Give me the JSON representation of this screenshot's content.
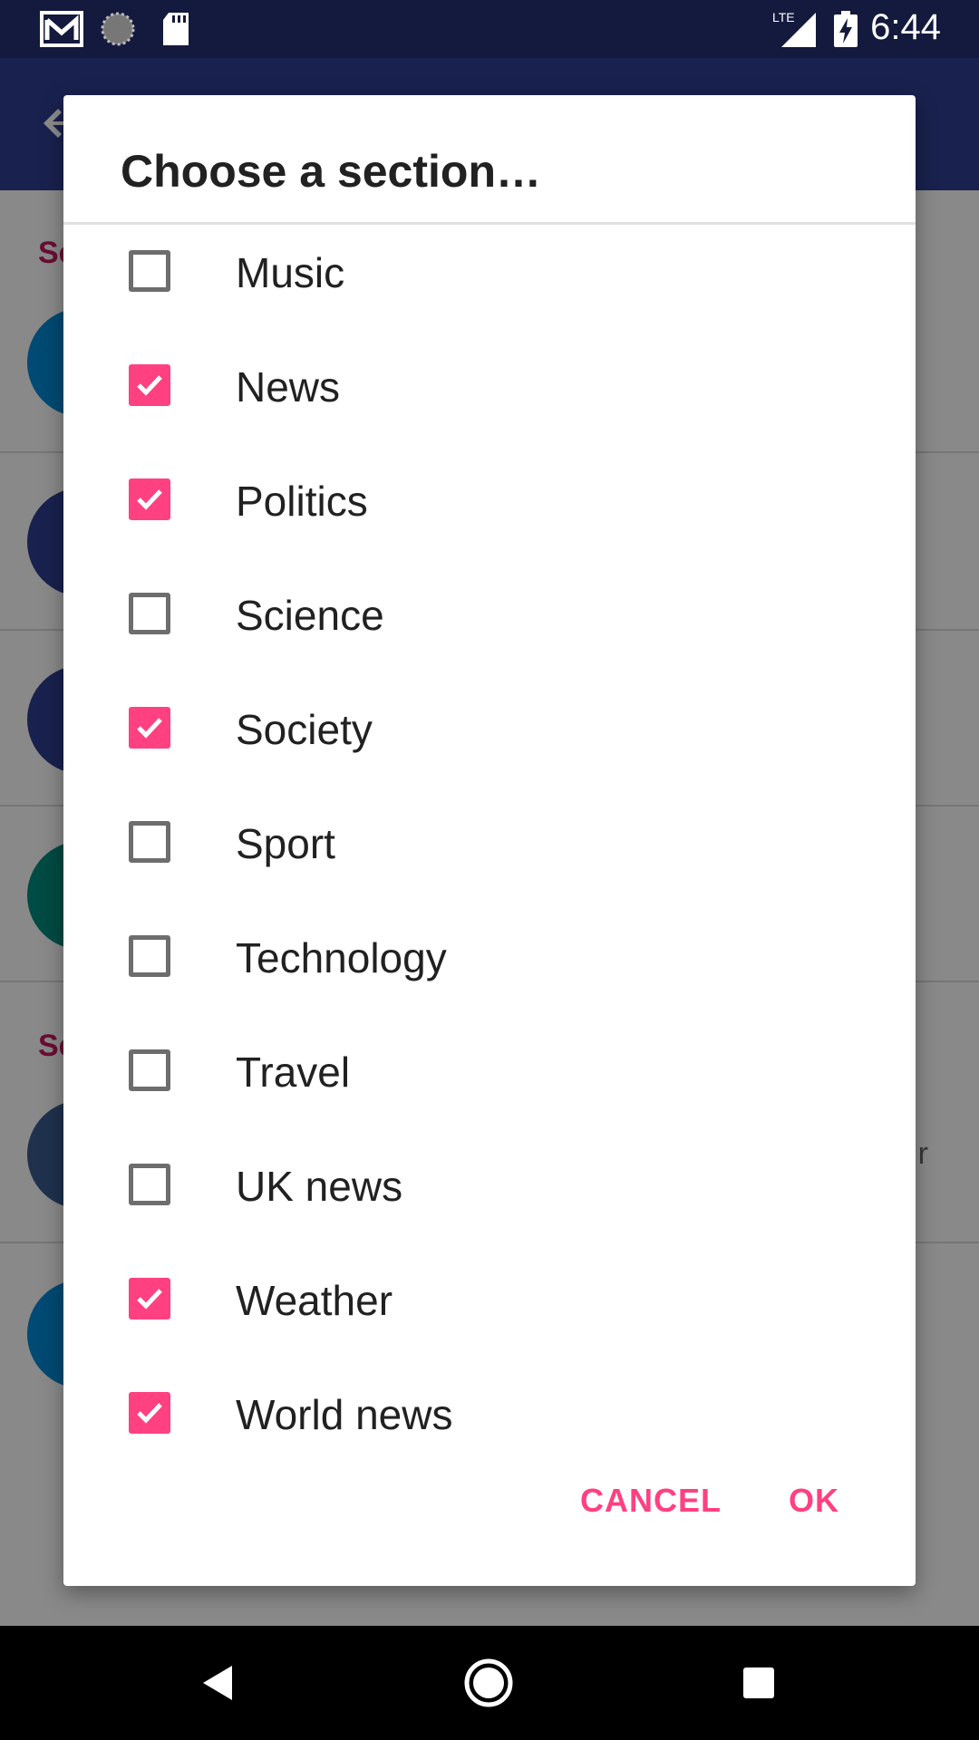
{
  "status_bar": {
    "time": "6:44",
    "network": "LTE",
    "icons": [
      "gmail-icon",
      "sync-icon",
      "sd-card-icon",
      "lte-signal-icon",
      "battery-charging-icon"
    ]
  },
  "dialog": {
    "title": "Choose a section…",
    "accent_color": "#ff4081",
    "options": [
      {
        "label": "Music",
        "checked": false
      },
      {
        "label": "News",
        "checked": true
      },
      {
        "label": "Politics",
        "checked": true
      },
      {
        "label": "Science",
        "checked": false
      },
      {
        "label": "Society",
        "checked": true
      },
      {
        "label": "Sport",
        "checked": false
      },
      {
        "label": "Technology",
        "checked": false
      },
      {
        "label": "Travel",
        "checked": false
      },
      {
        "label": "UK news",
        "checked": false
      },
      {
        "label": "Weather",
        "checked": true
      },
      {
        "label": "World news",
        "checked": true
      }
    ],
    "cancel_label": "CANCEL",
    "ok_label": "OK"
  },
  "background": {
    "section_header_1": "Se",
    "section_header_2": "Se",
    "trailing_text": "r"
  },
  "nav_bar": {
    "icons": [
      "back-icon",
      "home-icon",
      "recents-icon"
    ]
  }
}
